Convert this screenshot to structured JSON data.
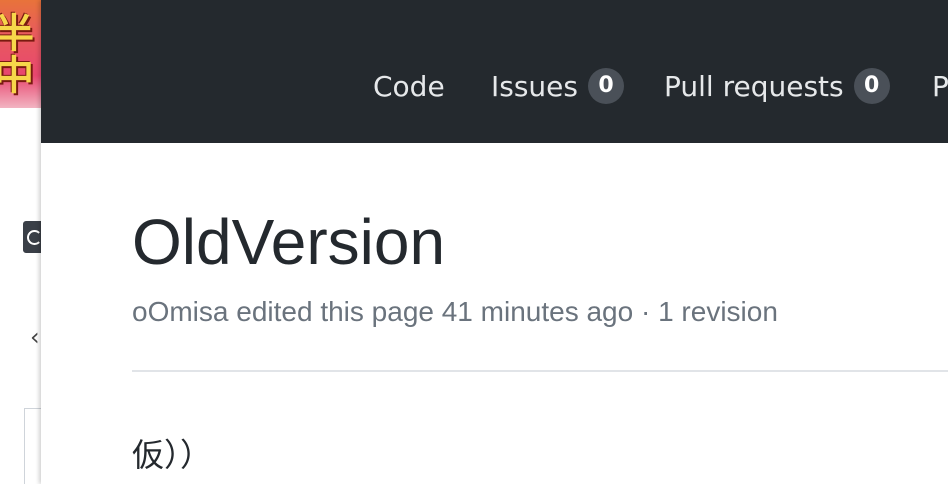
{
  "background_window": {
    "banner_glyphs": [
      "半",
      "中"
    ]
  },
  "nav": {
    "items": [
      {
        "label": "Code"
      },
      {
        "label": "Issues",
        "count": "0"
      },
      {
        "label": "Pull requests",
        "count": "0"
      },
      {
        "label": "P"
      }
    ]
  },
  "wiki": {
    "title": "OldVersion",
    "meta": "oOmisa edited this page 41 minutes ago · 1 revision",
    "body": "仮））"
  },
  "colors": {
    "header_bg": "#24292e",
    "counter_bg": "#4a5058",
    "meta_text": "#6a737d"
  }
}
